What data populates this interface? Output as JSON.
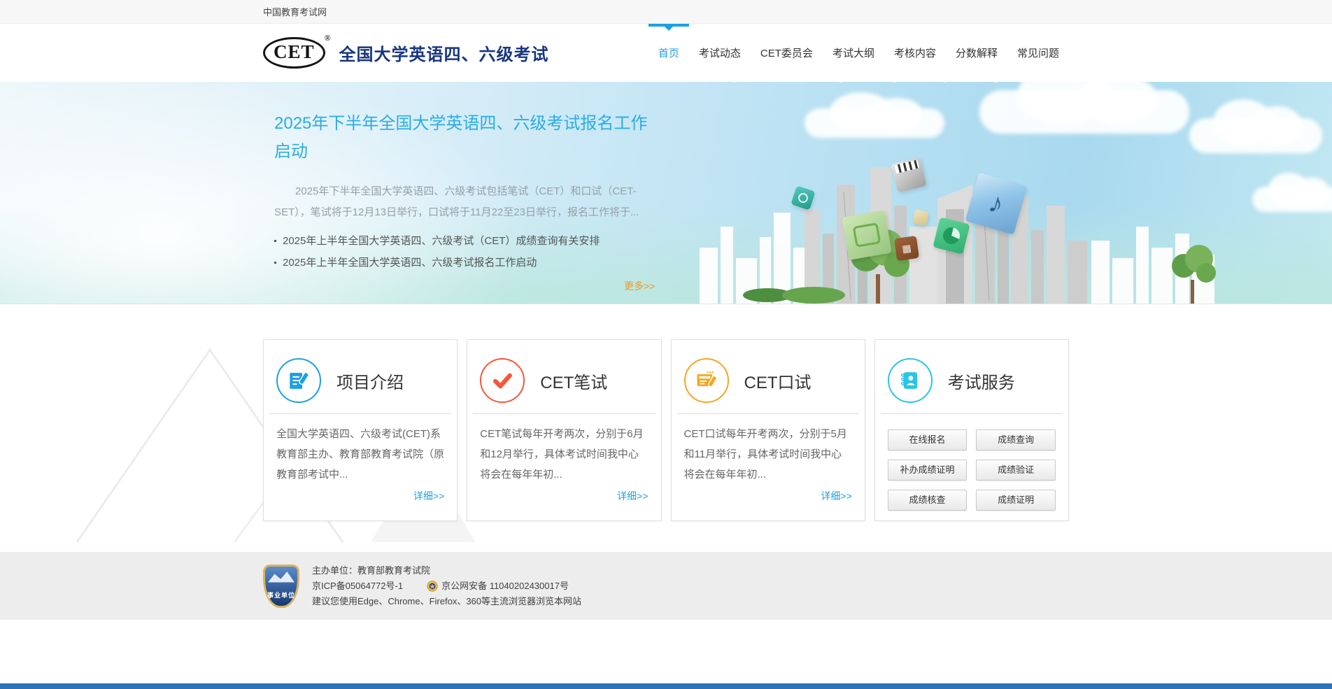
{
  "topbar": {
    "site_name": "中国教育考试网"
  },
  "header": {
    "logo_text": "CET",
    "logo_reg": "®",
    "site_title": "全国大学英语四、六级考试",
    "nav": [
      {
        "label": "首页",
        "active": true
      },
      {
        "label": "考试动态",
        "active": false
      },
      {
        "label": "CET委员会",
        "active": false
      },
      {
        "label": "考试大纲",
        "active": false
      },
      {
        "label": "考核内容",
        "active": false
      },
      {
        "label": "分数解释",
        "active": false
      },
      {
        "label": "常见问题",
        "active": false
      }
    ]
  },
  "banner": {
    "headline": "2025年下半年全国大学英语四、六级考试报名工作启动",
    "summary": "2025年下半年全国大学英语四、六级考试包括笔试（CET）和口试（CET-SET），笔试将于12月13日举行，口试将于11月22至23日举行，报名工作将于...",
    "news": [
      "2025年上半年全国大学英语四、六级考试（CET）成绩查询有关安排",
      "2025年上半年全国大学英语四、六级考试报名工作启动"
    ],
    "more_label": "更多>>"
  },
  "cards": [
    {
      "title": "项目介绍",
      "icon": "edit-document-icon",
      "accent_color": "#1ca0e3",
      "text": "全国大学英语四、六级考试(CET)系教育部主办、教育部教育考试院（原教育部考试中...",
      "link_label": "详细>>"
    },
    {
      "title": "CET笔试",
      "icon": "check-icon",
      "accent_color": "#f4593a",
      "text": "CET笔试每年开考两次，分别于6月和12月举行，具体考试时间我中心将会在每年年初...",
      "link_label": "详细>>"
    },
    {
      "title": "CET口试",
      "icon": "oral-test-icon",
      "accent_color": "#f5a623",
      "text": "CET口试每年开考两次，分别于5月和11月举行，具体考试时间我中心将会在每年年初...",
      "link_label": "详细>>"
    },
    {
      "title": "考试服务",
      "icon": "contact-book-icon",
      "accent_color": "#29c4e8",
      "buttons": [
        "在线报名",
        "成绩查询",
        "补办成绩证明",
        "成绩验证",
        "成绩核查",
        "成绩证明"
      ]
    }
  ],
  "footer": {
    "badge_label": "事业单位",
    "organizer": "主办单位：教育部教育考试院",
    "icp": "京ICP备05064772号-1",
    "police": "京公网安备 11040202430017号",
    "browser_tip": "建议您使用Edge、Chrome、Firefox、360等主流浏览器浏览本网站"
  },
  "colors": {
    "accent_blue": "#1ca0e3",
    "title_navy": "#17367e",
    "headline_blue": "#2aace4",
    "more_orange": "#f7941e",
    "card_red": "#f4593a",
    "card_orange": "#f5a623",
    "card_cyan": "#29c4e8",
    "footer_bg": "#ededed",
    "bottom_strip_blue": "#2e72b8"
  },
  "icons": {
    "edit-document-icon": "✎",
    "check-icon": "✔",
    "oral-test-icon": "✎",
    "contact-book-icon": "☰",
    "music-note-cube-icon": "♪",
    "police-badge-icon": "⛨"
  }
}
